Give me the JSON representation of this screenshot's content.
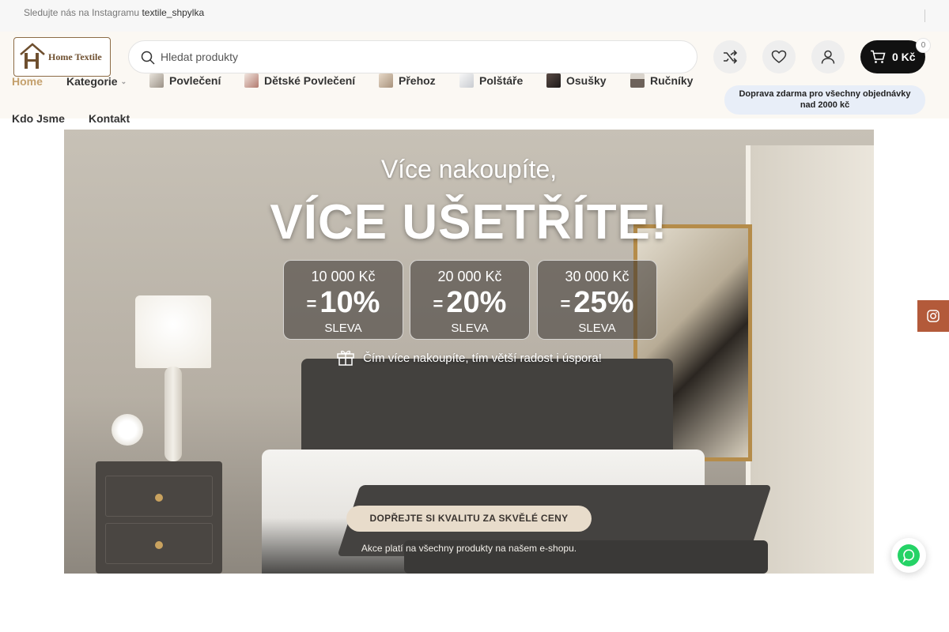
{
  "topbar": {
    "instagram_prefix": "Sledujte nás na Instagramu",
    "instagram_handle": "textile_shpylka"
  },
  "logo": {
    "text": "Home Textile"
  },
  "search": {
    "placeholder": "Hledat produkty"
  },
  "header_actions": {
    "compare_icon": "shuffle-icon",
    "wishlist_icon": "heart-icon",
    "account_icon": "user-icon",
    "cart_amount": "0 Kč",
    "cart_count": "0"
  },
  "nav": {
    "home": "Home",
    "kategorie": "Kategorie",
    "povleceni": "Povlečení",
    "detske": "Dětské Povlečení",
    "prehoz": "Přehoz",
    "polstare": "Polštáře",
    "osusky": "Osušky",
    "rucniky": "Ručníky",
    "kdo_jsme": "Kdo Jsme",
    "kontakt": "Kontakt"
  },
  "shipping_badge": {
    "line1": "Doprava zdarma pro všechny objednávky",
    "line2": "nad 2000 kč"
  },
  "banner": {
    "headline_1": "Více nakoupíte,",
    "headline_2": "VÍCE UŠETŘÍTE!",
    "tiers": [
      {
        "threshold": "10 000 Kč",
        "percent": "10%",
        "label": "SLEVA"
      },
      {
        "threshold": "20 000 Kč",
        "percent": "20%",
        "label": "SLEVA"
      },
      {
        "threshold": "30 000 Kč",
        "percent": "25%",
        "label": "SLEVA"
      }
    ],
    "equals": "=",
    "motto": "Čím více nakoupíte, tím větší radost i úspora!",
    "cta": "DOPŘEJTE SI KVALITU ZA SKVĚLÉ CENY",
    "note": "Akce platí na všechny produkty na našem e-shopu."
  },
  "colors": {
    "accent": "#c4a06c",
    "header_bg": "#fbf8f3",
    "cart_bg": "#111111",
    "shipping_bg": "#e8eef8",
    "instagram_side": "#b35a3a",
    "whatsapp": "#25d366"
  }
}
